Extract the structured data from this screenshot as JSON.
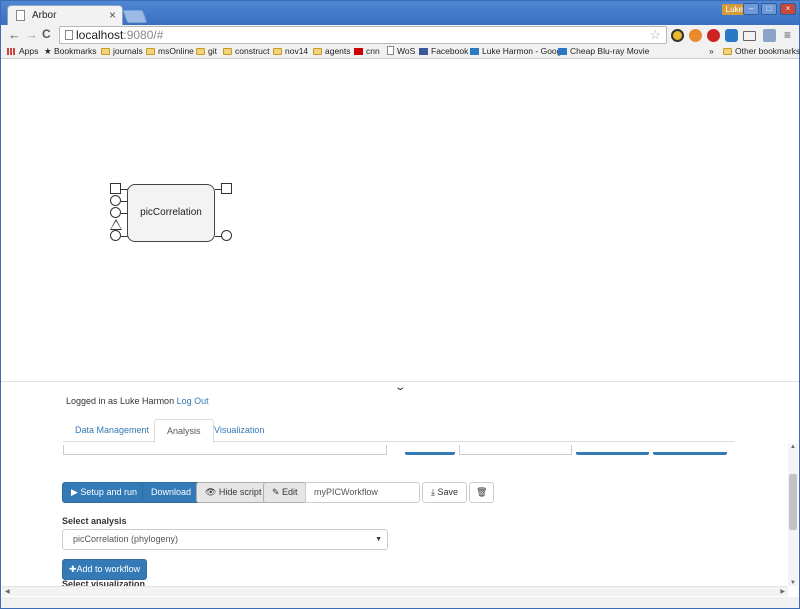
{
  "browser": {
    "tab_title": "Arbor",
    "tab_close": "×",
    "user_badge": "Luke",
    "window_buttons": [
      "–",
      "□",
      "×"
    ],
    "url_host": "localhost",
    "url_rest": ":9080/#",
    "nav": {
      "back": "←",
      "forward": "→",
      "reload": "C"
    },
    "star": "☆",
    "menu": "≡",
    "bookmarks": [
      {
        "label": "Apps",
        "icon": "apps-icon"
      },
      {
        "label": "Bookmarks",
        "icon": "star-icon"
      },
      {
        "label": "journals",
        "icon": "folder-icon"
      },
      {
        "label": "msOnline",
        "icon": "folder-icon"
      },
      {
        "label": "git",
        "icon": "folder-icon"
      },
      {
        "label": "construct",
        "icon": "folder-icon"
      },
      {
        "label": "nov14",
        "icon": "folder-icon"
      },
      {
        "label": "agents",
        "icon": "folder-icon"
      },
      {
        "label": "cnn",
        "icon": "cnn-icon"
      },
      {
        "label": "WoS",
        "icon": "page-icon"
      },
      {
        "label": "Facebook",
        "icon": "facebook-icon"
      },
      {
        "label": "Luke Harmon - Goog",
        "icon": "scholar-icon"
      },
      {
        "label": "Cheap Blu-ray Movie",
        "icon": "bluray-icon"
      }
    ],
    "bookmarks_overflow": "»",
    "other_bookmarks": "Other bookmarks"
  },
  "workflow": {
    "node_label": "picCorrelation"
  },
  "panel": {
    "collapse_chevron": "⌄",
    "logged_in_prefix": "Logged in as Luke Harmon",
    "logout_label": "Log Out",
    "tabs": [
      "Data Management",
      "Analysis",
      "Visualization"
    ],
    "active_tab": "Analysis",
    "buttons": {
      "setup_run": "▶ Setup and run",
      "download": "Download",
      "hide_script": "👁 Hide script",
      "edit": "✎ Edit",
      "save": "⤓ Save",
      "delete": "🗑"
    },
    "workflow_name": "myPICWorkflow",
    "select_analysis_label": "Select analysis",
    "analysis_value": "picCorrelation (phylogeny)",
    "caret": "▼",
    "add_to_workflow": "✚Add to workflow",
    "select_visualization_label": "Select visualization"
  },
  "colors": {
    "primary": "#337ab7",
    "chrome_frame": "#3a70c0"
  }
}
